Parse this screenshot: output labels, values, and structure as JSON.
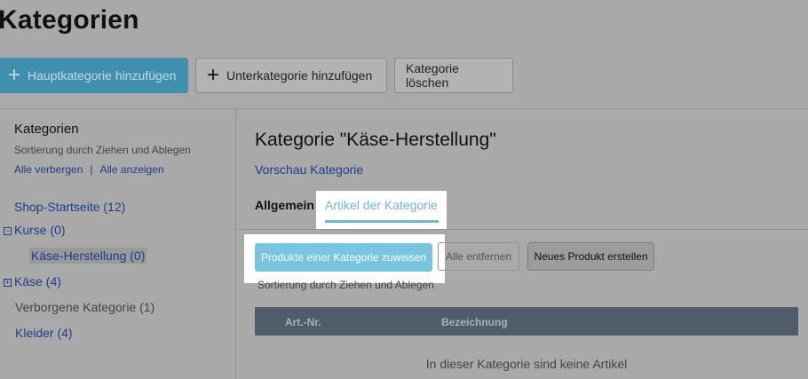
{
  "page": {
    "title": "Kategorien"
  },
  "toolbar": {
    "add_main": {
      "icon": "plus-icon",
      "label": "Hauptkategorie hinzufügen"
    },
    "add_sub": {
      "icon": "plus-icon",
      "label": "Unterkategorie hinzufügen"
    },
    "delete": {
      "label": "Kategorie löschen"
    }
  },
  "sidebar": {
    "title": "Kategorien",
    "hint": "Sortierung durch Ziehen und Ablegen",
    "hide_all": "Alle verbergen",
    "separator": "|",
    "show_all": "Alle anzeigen",
    "tree": [
      {
        "label": "Shop-Startseite (12)",
        "toggle": ""
      },
      {
        "label": "Kurse (0)",
        "toggle": "−"
      },
      {
        "label": "Käse-Herstellung (0)",
        "toggle": "",
        "selected": true
      },
      {
        "label": "Käse (4)",
        "toggle": "+"
      },
      {
        "label": "Verborgene Kategorie (1)",
        "toggle": ""
      },
      {
        "label": "Kleider (4)",
        "toggle": ""
      }
    ]
  },
  "main": {
    "category_title": "Kategorie \"Käse-Herstellung\"",
    "preview_link": "Vorschau Kategorie",
    "tabs": [
      {
        "label": "Allgemein",
        "active": false
      },
      {
        "label": "Artikel der Kategorie",
        "active": true
      }
    ],
    "assign_button": "Produkte einer Kategorie zuweisen",
    "remove_all_button": "Alle entfernen",
    "new_product_button": "Neues Produkt erstellen",
    "sort_hint": "Sortierung durch Ziehen und Ablegen",
    "table": {
      "columns": [
        "Art.-Nr.",
        "Bezeichnung"
      ],
      "empty_message": "In dieser Kategorie sind keine Artikel"
    }
  },
  "colors": {
    "accent": "#6fb8d3",
    "primary_button": "#3f8fae",
    "link": "#1f3d8a",
    "table_header": "#4f5d6a",
    "overlay_background": "#a9a9a9"
  }
}
